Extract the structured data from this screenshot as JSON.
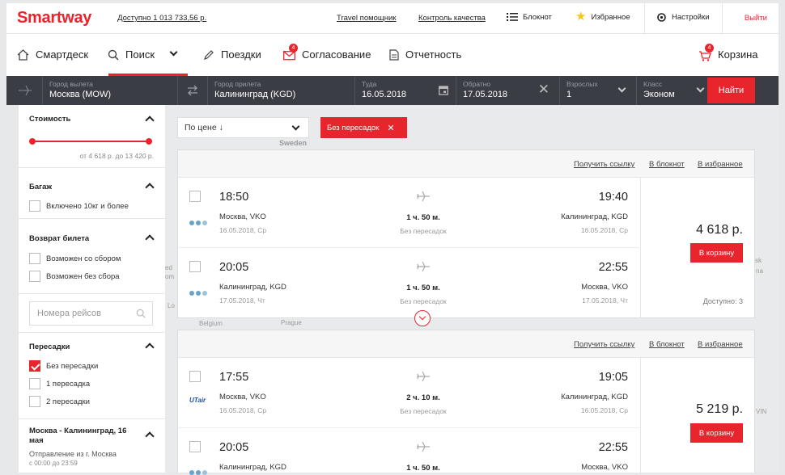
{
  "topbar": {
    "logo": "Smartway",
    "balance": "Доступно 1 013 733,56 р.",
    "travel_helper": "Travel помощник",
    "quality_control": "Контроль качества",
    "notebook": "Блокнот",
    "favorites": "Избранное",
    "settings": "Настройки",
    "exit": "Выйти"
  },
  "nav": {
    "smartdesk": "Смартдеск",
    "search": "Поиск",
    "trips": "Поездки",
    "approval": "Согласование",
    "approval_badge": "4",
    "reports": "Отчетность",
    "cart": "Корзина",
    "cart_badge": "4"
  },
  "searchbar": {
    "from_label": "Город вылета",
    "from_value": "Москва (MOW)",
    "to_label": "Город прилета",
    "to_value": "Калининград (KGD)",
    "there_label": "Туда",
    "there_value": "16.05.2018",
    "back_label": "Обратно",
    "back_value": "17.05.2018",
    "adults_label": "Взрослых",
    "adults_value": "1",
    "class_label": "Класс",
    "class_value": "Эконом",
    "find": "Найти"
  },
  "sidebar": {
    "cost_title": "Стоимость",
    "cost_range": "от 4 618 р. до 13 420 р.",
    "baggage_title": "Багаж",
    "baggage_option": "Включено 10кг и более",
    "refund_title": "Возврат билета",
    "refund_option1": "Возможен со сбором",
    "refund_option2": "Возможен без сбора",
    "flight_numbers_placeholder": "Номера рейсов",
    "transfers_title": "Пересадки",
    "transfer_option0": "Без пересадки",
    "transfer_option1": "1 пересадка",
    "transfer_option2": "2 пересадки",
    "route_title": "Москва - Калининград, 16 мая",
    "departure_from": "Отправление из г. Москва",
    "departure_time": "с 00:00 до 23:59"
  },
  "sort": {
    "label": "По цене ↓"
  },
  "filter_chip": "Без пересадок",
  "map_labels": {
    "sweden": "Sweden",
    "belgium": "Belgium",
    "prague": "Prague",
    "ned": "ed",
    "nom": "om",
    "nlo": "Lo",
    "nsk": "sk",
    "nna": "na",
    "nvin": "VIN"
  },
  "cards": [
    {
      "links": {
        "get_link": "Получить ссылку",
        "to_notebook": "В блокнот",
        "to_favorites": "В избранное"
      },
      "segments": [
        {
          "dep_time": "18:50",
          "dep_city": "Москва, VKO",
          "dep_date": "16.05.2018, Ср",
          "duration": "1 ч. 50 м.",
          "stops": "Без пересадок",
          "arr_time": "19:40",
          "arr_city": "Калининград, KGD",
          "arr_date": "16.05.2018, Ср",
          "airline": ""
        },
        {
          "dep_time": "20:05",
          "dep_city": "Калининград, KGD",
          "dep_date": "17.05.2018, Чт",
          "duration": "1 ч. 50 м.",
          "stops": "Без пересадок",
          "arr_time": "22:55",
          "arr_city": "Москва, VKO",
          "arr_date": "17.05.2018, Чт",
          "airline": ""
        }
      ],
      "price": "4 618 р.",
      "cart_button": "В корзину",
      "available": "Доступно: 3"
    },
    {
      "links": {
        "get_link": "Получить ссылку",
        "to_notebook": "В блокнот",
        "to_favorites": "В избранное"
      },
      "segments": [
        {
          "dep_time": "17:55",
          "dep_city": "Москва, VKO",
          "dep_date": "16.05.2018, Ср",
          "duration": "2 ч. 10 м.",
          "stops": "Без пересадок",
          "arr_time": "19:05",
          "arr_city": "Калининград, KGD",
          "arr_date": "16.05.2018, Ср",
          "airline": "UTair"
        },
        {
          "dep_time": "20:05",
          "dep_city": "Калининград, KGD",
          "dep_date": "",
          "duration": "1 ч. 50 м.",
          "stops": "",
          "arr_time": "22:55",
          "arr_city": "Москва, VKO",
          "arr_date": "",
          "airline": ""
        }
      ],
      "price": "5 219 р.",
      "cart_button": "В корзину",
      "available": ""
    }
  ],
  "colors": {
    "accent": "#e8242d",
    "dark": "#3a3d44"
  }
}
